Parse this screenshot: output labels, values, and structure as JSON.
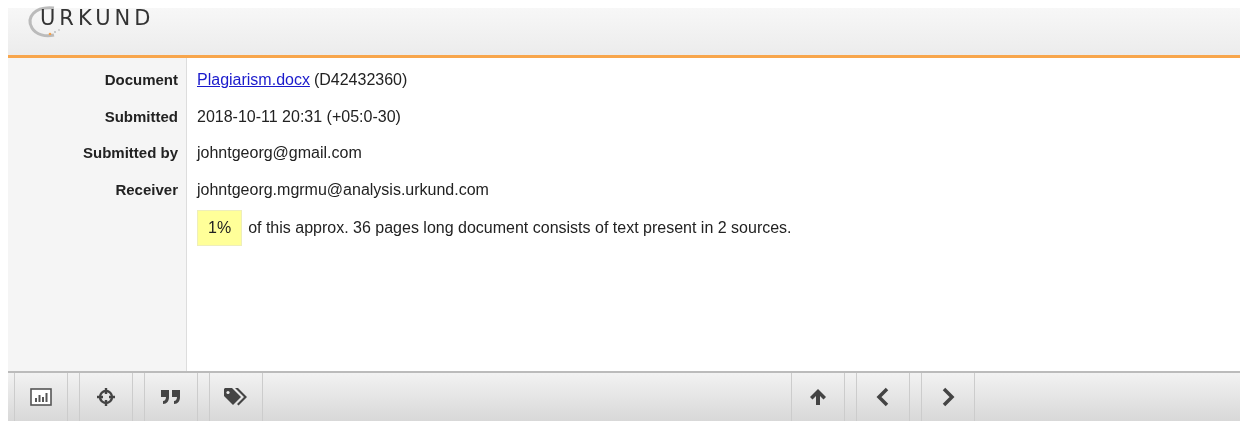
{
  "header": {
    "logo": "URKUND"
  },
  "details": [
    {
      "label": "Document",
      "link": "Plagiarism.docx",
      "text": "(D42432360)"
    },
    {
      "label": "Submitted",
      "text": "2018-10-11 20:31 (+05:0-30)"
    },
    {
      "label": "Submitted by",
      "text": "johntgeorg@gmail.com"
    },
    {
      "label": "Receiver",
      "text": "johntgeorg.mgrmu@analysis.urkund.com"
    }
  ],
  "summary": {
    "percent": "1%",
    "text": "of this approx. 36 pages long document consists of text present in 2 sources."
  },
  "toolbar": {
    "left": [
      {
        "kind": "chart"
      },
      {
        "kind": "target"
      },
      {
        "kind": "quote"
      },
      {
        "kind": "tags"
      }
    ],
    "right": [
      {
        "kind": "up"
      },
      {
        "kind": "prev"
      },
      {
        "kind": "next"
      }
    ]
  }
}
